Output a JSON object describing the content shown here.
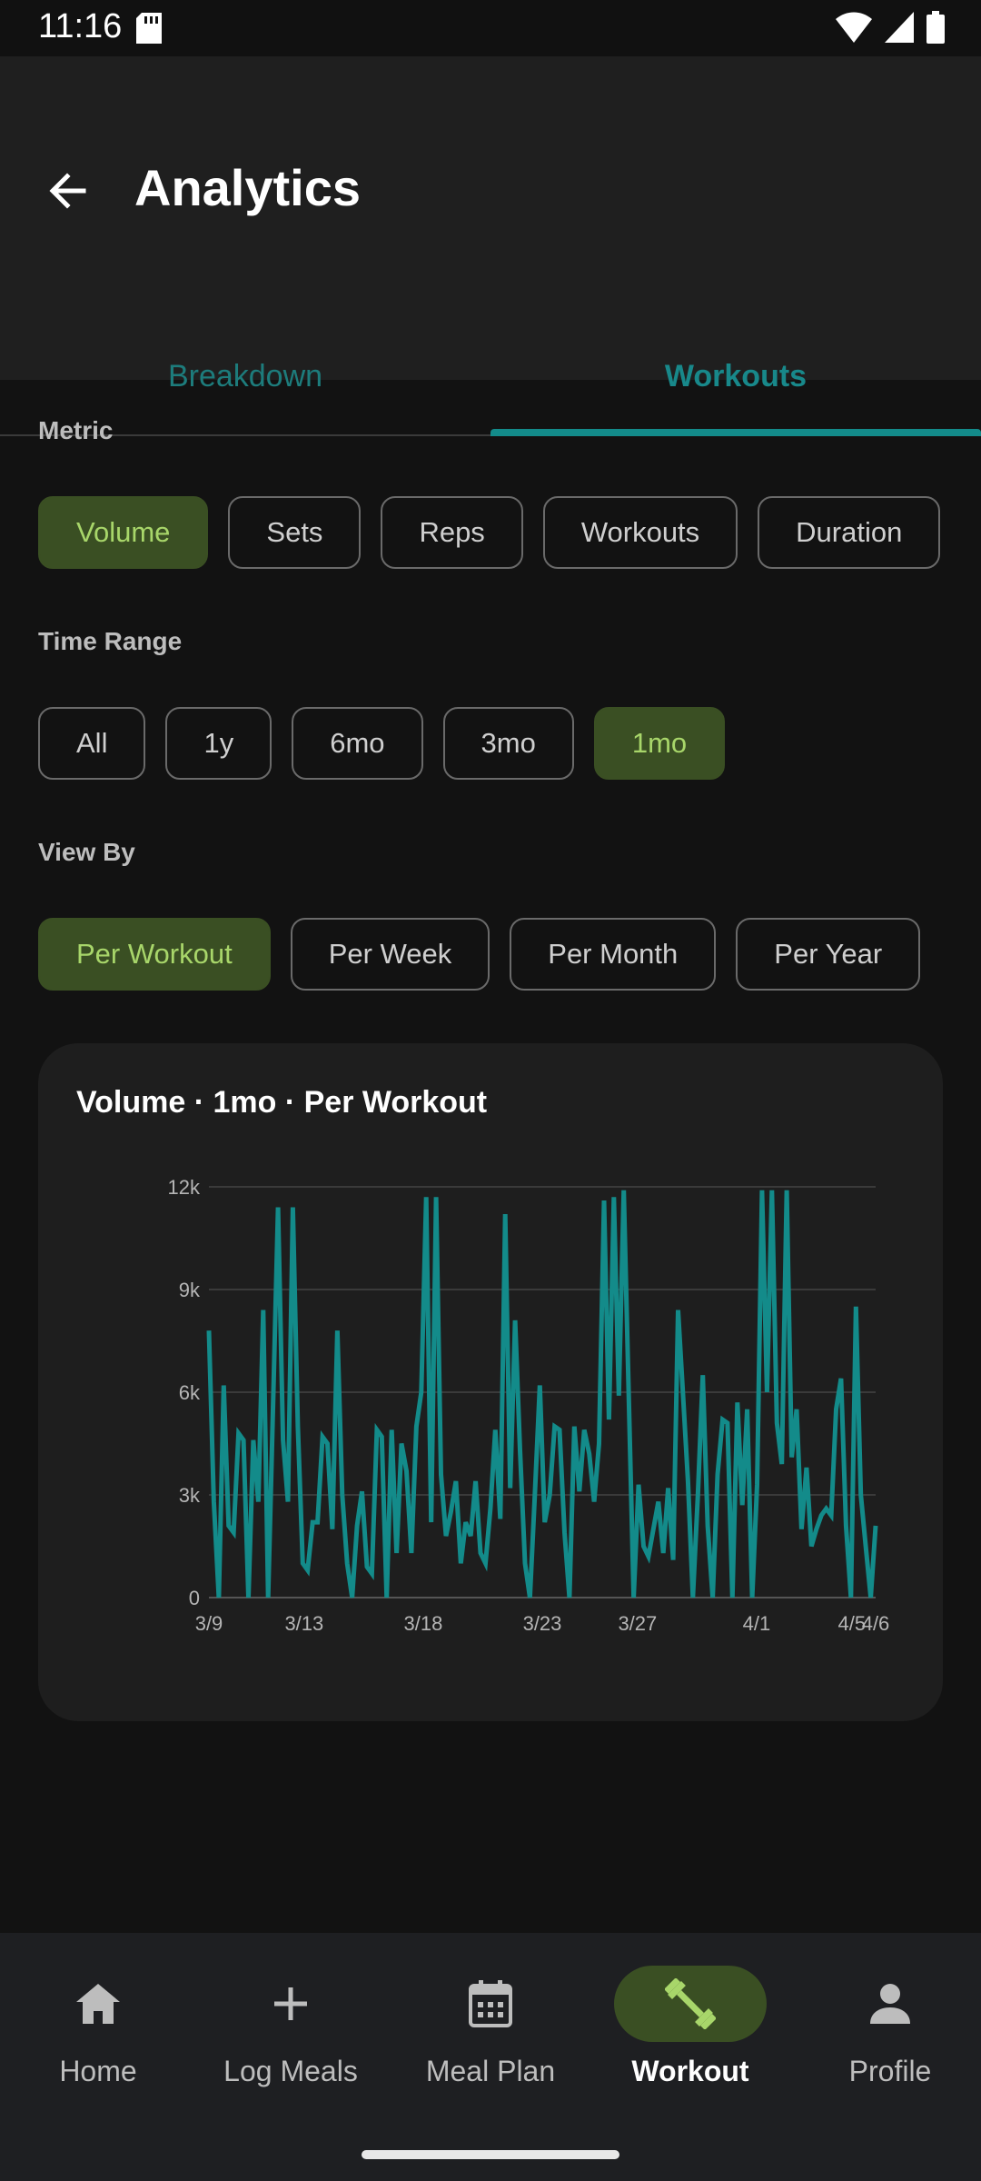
{
  "status_bar": {
    "time": "11:16"
  },
  "app_bar": {
    "title": "Analytics"
  },
  "tabs": [
    {
      "label": "Breakdown"
    },
    {
      "label": "Workouts"
    }
  ],
  "metric": {
    "label": "Metric",
    "options": [
      "Volume",
      "Sets",
      "Reps",
      "Workouts",
      "Duration"
    ],
    "selected": "Volume"
  },
  "time_range": {
    "label": "Time Range",
    "options": [
      "All",
      "1y",
      "6mo",
      "3mo",
      "1mo"
    ],
    "selected": "1mo"
  },
  "view_by": {
    "label": "View By",
    "options": [
      "Per Workout",
      "Per Week",
      "Per Month",
      "Per Year"
    ],
    "selected": "Per Workout"
  },
  "card": {
    "title": "Volume · 1mo · Per Workout"
  },
  "colors": {
    "accent": "#138b8a",
    "selected_chip_bg": "#3a4f23",
    "selected_chip_text": "#a8d66a"
  },
  "chart_data": {
    "type": "line",
    "title": "Volume · 1mo · Per Workout",
    "ylim": [
      0,
      12000
    ],
    "y_ticks": [
      0,
      3000,
      6000,
      9000,
      12000
    ],
    "y_tick_labels": [
      "0",
      "3k",
      "6k",
      "9k",
      "12k"
    ],
    "x_range": [
      "2024-03-09",
      "2024-04-06"
    ],
    "x_tick_labels": [
      "3/9",
      "3/13",
      "3/18",
      "3/23",
      "3/27",
      "4/1",
      "4/5",
      "4/6"
    ],
    "grid": true,
    "series": [
      {
        "values": [
          7800,
          2800,
          0,
          6200,
          2100,
          1900,
          4800,
          4600,
          0,
          4600,
          2800,
          8400,
          0,
          5700,
          11400,
          4600,
          2800,
          11400,
          5000,
          1000,
          800,
          2200,
          2200,
          4700,
          4500,
          2000,
          7800,
          3000,
          1000,
          0,
          2100,
          3100,
          900,
          700,
          4900,
          4700,
          0,
          4900,
          1300,
          4500,
          3700,
          1300,
          5000,
          6000,
          11700,
          2200,
          11700,
          3600,
          1800,
          2500,
          3400,
          1000,
          2200,
          1800,
          3400,
          1300,
          1000,
          2600,
          4900,
          2300,
          11200,
          3200,
          8100,
          4300,
          1000,
          0,
          3000,
          6200,
          2200,
          3000,
          5000,
          4900,
          1900,
          0,
          5000,
          3100,
          4900,
          4200,
          2800,
          4500,
          11600,
          5200,
          11700,
          5900,
          11900,
          6000,
          0,
          3300,
          1500,
          1200,
          2000,
          2800,
          1300,
          3200,
          1100,
          8400,
          5900,
          3400,
          0,
          3000,
          6500,
          2100,
          0,
          3600,
          5200,
          5100,
          0,
          5700,
          2700,
          5500,
          0,
          3300,
          11900,
          6000,
          11900,
          5100,
          3900,
          11900,
          4100,
          5500,
          2000,
          3800,
          1500,
          2000,
          2400,
          2600,
          2400,
          5500,
          6400,
          2100,
          0,
          8500,
          3000,
          1500,
          0,
          2100
        ]
      }
    ]
  }
}
